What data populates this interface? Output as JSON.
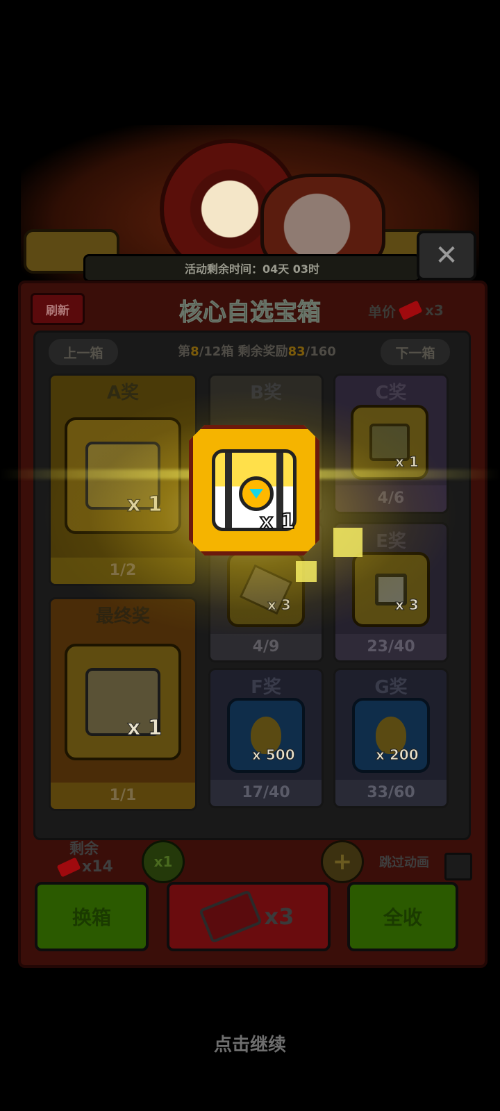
{
  "banner": {
    "timer_text": "活动剩余时间：04天 03时",
    "close_icon": "close-icon"
  },
  "header": {
    "refresh_label": "刷新",
    "title": "核心自选宝箱",
    "price_label": "单价",
    "price_qty": "x3"
  },
  "box_nav": {
    "prev_label": "上一箱",
    "next_label": "下一箱",
    "box_prefix": "第",
    "box_current": "8",
    "box_suffix": "/12箱  剩余奖励",
    "reward_remaining": "83",
    "reward_total": "/160"
  },
  "prizes": {
    "a": {
      "label": "A奖",
      "qty": "x 1",
      "count": "1/2",
      "icon": "chest-icon"
    },
    "b": {
      "label": "B奖"
    },
    "c": {
      "label": "C奖",
      "qty": "x 1",
      "count": "4/6",
      "icon": "chip-icon"
    },
    "d": {
      "qty": "x 3",
      "count": "4/9",
      "icon": "blueprint-icon"
    },
    "e": {
      "label": "E奖",
      "qty": "x 3",
      "count": "23/40",
      "icon": "key-icon"
    },
    "final": {
      "label": "最终奖",
      "qty": "x 1",
      "count": "1/1",
      "icon": "chest-icon"
    },
    "f": {
      "label": "F奖",
      "qty": "x 500",
      "count": "17/40",
      "icon": "oil-drop-icon"
    },
    "g": {
      "label": "G奖",
      "qty": "x 200",
      "count": "33/60",
      "icon": "oil-drop-icon"
    }
  },
  "footer": {
    "remain_label": "剩余",
    "remain_value": "x14",
    "multiplier": "x1",
    "plus": "+",
    "skip_label": "跳过动画",
    "change_box_label": "换箱",
    "draw_cost": "x3",
    "collect_all_label": "全收"
  },
  "featured_reward": {
    "qty": "x 1",
    "icon": "chest-icon"
  },
  "tap_continue": "点击继续",
  "colors": {
    "accent_gold": "#f5b400",
    "panel_red": "#3a0e09",
    "button_green": "#2b5a00",
    "button_red": "#6a0c0e"
  }
}
